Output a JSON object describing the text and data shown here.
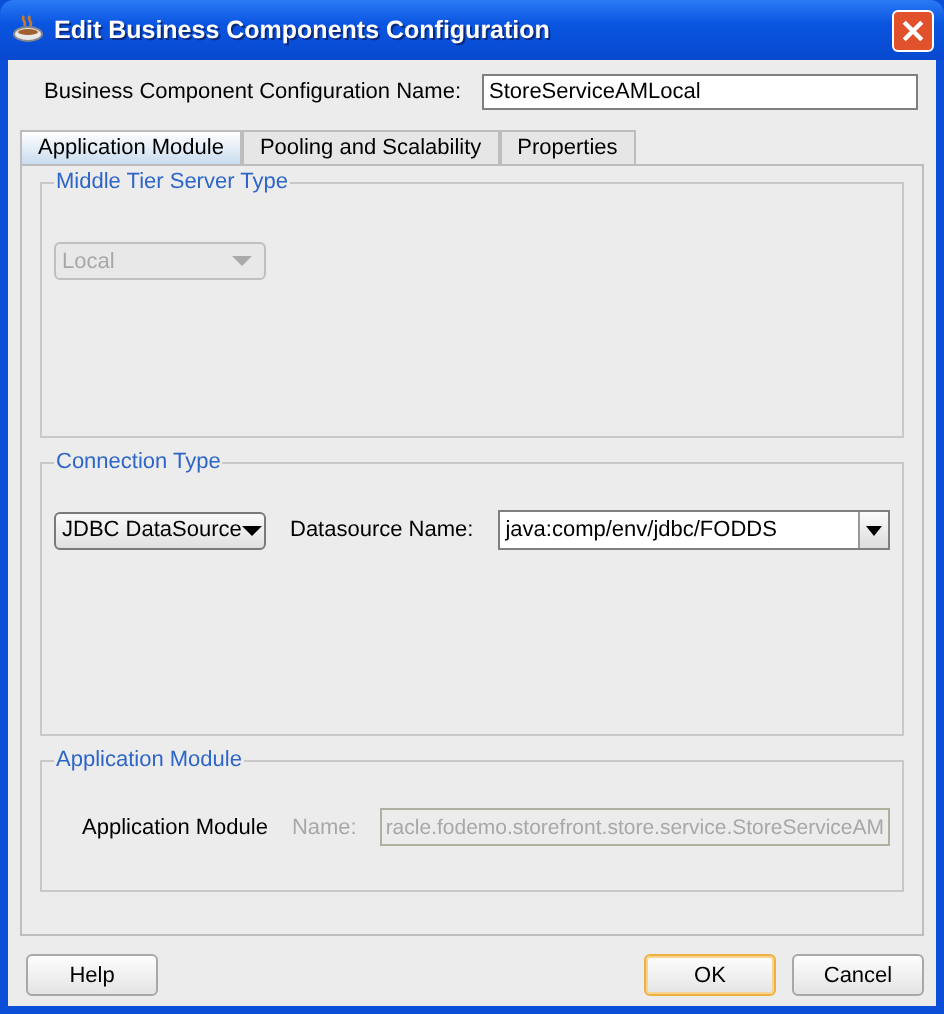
{
  "window": {
    "title": "Edit Business Components Configuration"
  },
  "config_name": {
    "label": "Business Component Configuration Name:",
    "value": "StoreServiceAMLocal"
  },
  "tabs": [
    {
      "label": "Application Module",
      "selected": true
    },
    {
      "label": "Pooling and Scalability",
      "selected": false
    },
    {
      "label": "Properties",
      "selected": false
    }
  ],
  "middle_tier": {
    "title": "Middle Tier Server Type",
    "server_type": {
      "value": "Local",
      "disabled": true
    }
  },
  "connection": {
    "title": "Connection Type",
    "type": {
      "value": "JDBC DataSource",
      "disabled": false
    },
    "datasource": {
      "label": "Datasource Name:",
      "value": "java:comp/env/jdbc/FODDS"
    }
  },
  "application_module": {
    "title": "Application Module",
    "label": "Application Module",
    "name_label": "Name:",
    "name_value": "racle.fodemo.storefront.store.service.StoreServiceAM",
    "disabled": true
  },
  "buttons": [
    {
      "label": "Help",
      "default": false
    },
    {
      "label": "OK",
      "default": true
    },
    {
      "label": "Cancel",
      "default": false
    }
  ]
}
